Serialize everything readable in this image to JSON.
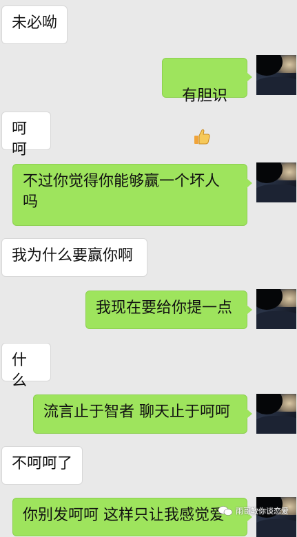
{
  "messages": [
    {
      "side": "in",
      "text": "未必呦"
    },
    {
      "side": "out",
      "text": "有胆识",
      "emoji": "thumbs-up-icon"
    },
    {
      "side": "in",
      "text": "呵呵"
    },
    {
      "side": "out",
      "text": "不过你觉得你能够赢一个坏人\n吗"
    },
    {
      "side": "in",
      "text": "我为什么要赢你啊"
    },
    {
      "side": "out",
      "text": "我现在要给你提一点"
    },
    {
      "side": "in",
      "text": "什么"
    },
    {
      "side": "out",
      "text": "流言止于智者 聊天止于呵呵"
    },
    {
      "side": "in",
      "text": "不呵呵了"
    },
    {
      "side": "out",
      "text": "你别发呵呵 这样只让我感觉爱"
    }
  ],
  "watermark": {
    "text": "雨哥教你谈恋爱"
  },
  "colors": {
    "outgoing_bubble": "#9ee45d",
    "incoming_bubble": "#ffffff",
    "background": "#e9e9e9"
  }
}
